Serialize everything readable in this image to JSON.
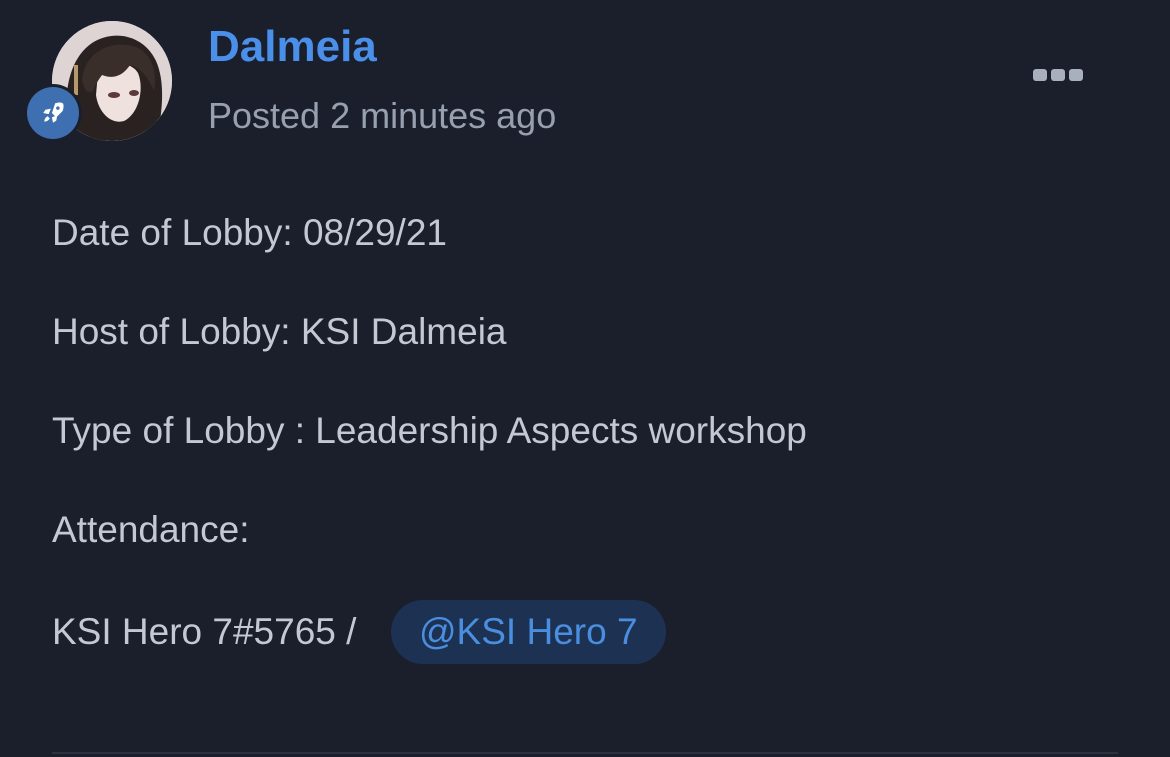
{
  "post": {
    "author": "Dalmeia",
    "posted": "Posted 2 minutes ago",
    "author_color": "#4a90ea",
    "badge_icon": "rocket-icon",
    "menu_icon": "more-options-icon",
    "lines": [
      "Date of Lobby: 08/29/21",
      "Host of Lobby: KSI Dalmeia",
      "Type of Lobby : Leadership Aspects workshop",
      "Attendance:",
      "KSI Hero 7#5765 /"
    ],
    "mention": "@KSI Hero 7"
  }
}
